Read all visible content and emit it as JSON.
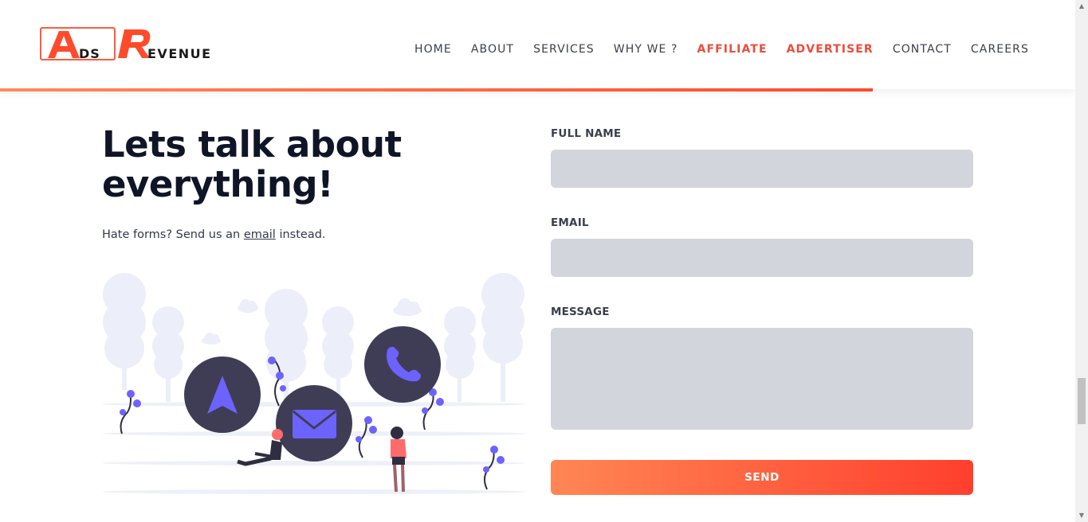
{
  "brand": {
    "logo_text_1": "ADS",
    "logo_text_2": "REVENUE",
    "accent": "#ff4b2b",
    "accent_light": "#ff8a5c"
  },
  "nav": {
    "items": [
      {
        "label": "HOME"
      },
      {
        "label": "ABOUT"
      },
      {
        "label": "SERVICES"
      },
      {
        "label": "WHY WE ?"
      },
      {
        "label": "AFFILIATE"
      },
      {
        "label": "ADVERTISER"
      },
      {
        "label": "CONTACT"
      },
      {
        "label": "CAREERS"
      }
    ]
  },
  "hero": {
    "title": "Lets talk about everything!",
    "sub_before": "Hate forms? Send us an ",
    "sub_link": "email",
    "sub_after": " instead."
  },
  "form": {
    "name_label": "FULL NAME",
    "email_label": "EMAIL",
    "message_label": "MESSAGE",
    "send_label": "SEND"
  },
  "icons": {
    "illustration_icons": [
      "navigation-icon",
      "mail-icon",
      "phone-icon"
    ]
  }
}
